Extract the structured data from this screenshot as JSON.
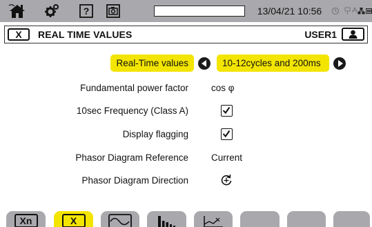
{
  "colors": {
    "statusbar": "#a9a9ad",
    "highlight": "#f3e500",
    "tab": "#a9a9ad"
  },
  "statusbar": {
    "icons": [
      "home-icon",
      "settings-icon",
      "help-icon",
      "camera-icon",
      "alarm-icon",
      "usb-icon",
      "network-icon",
      "battery-icon"
    ],
    "datetime": "13/04/21 10:56"
  },
  "titlebar": {
    "close_label": "X",
    "title": "REAL TIME VALUES",
    "user": "USER1",
    "user_icon": "user-icon"
  },
  "settings": {
    "mode_label": "Real-Time values",
    "mode_value": "10-12cycles and 200ms",
    "power_factor_label": "Fundamental power factor",
    "power_factor_value": "cos φ",
    "frequency_label": "10sec Frequency (Class A)",
    "frequency_checked": true,
    "flagging_label": "Display flagging",
    "flagging_checked": true,
    "phasor_ref_label": "Phasor Diagram Reference",
    "phasor_ref_value": "Current",
    "phasor_dir_label": "Phasor Diagram Direction",
    "phasor_dir_icon": "rotate-counterclockwise-icon"
  },
  "tabs": [
    {
      "label": "Xn",
      "active": false
    },
    {
      "label": "X",
      "active": true
    },
    {
      "icon": "sine-wave-icon",
      "active": false
    },
    {
      "icon": "harmonics-bars-icon",
      "active": false
    },
    {
      "icon": "trend-graph-icon",
      "active": false
    },
    {
      "label": "",
      "active": false
    },
    {
      "label": "",
      "active": false
    },
    {
      "label": "",
      "active": false
    }
  ]
}
